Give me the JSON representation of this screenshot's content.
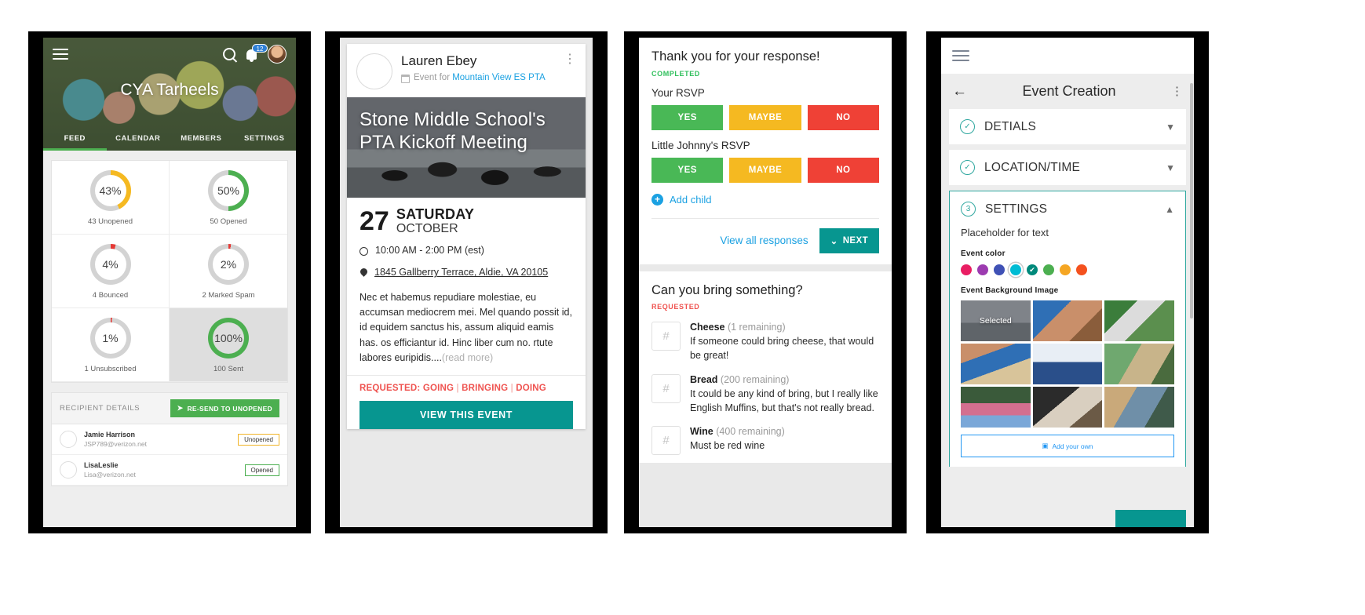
{
  "phone1": {
    "header": {
      "menu_icon": "hamburger-icon",
      "search_icon": "search-icon",
      "bell_icon": "bell-icon",
      "notification_count": "12",
      "avatar": "user-avatar",
      "group_title": "CYA Tarheels"
    },
    "tabs": [
      {
        "label": "FEED",
        "active": true
      },
      {
        "label": "CALENDAR",
        "active": false
      },
      {
        "label": "MEMBERS",
        "active": false
      },
      {
        "label": "SETTINGS",
        "active": false
      }
    ],
    "stats": [
      {
        "percent": "43%",
        "label": "43 Unopened",
        "color": "#f5b921",
        "pct": 43,
        "shaded": false
      },
      {
        "percent": "50%",
        "label": "50 Opened",
        "color": "#4caf50",
        "pct": 50,
        "shaded": false
      },
      {
        "percent": "4%",
        "label": "4 Bounced",
        "color": "#e53935",
        "pct": 4,
        "shaded": false
      },
      {
        "percent": "2%",
        "label": "2 Marked Spam",
        "color": "#e53935",
        "pct": 2,
        "shaded": false
      },
      {
        "percent": "1%",
        "label": "1 Unsubscribed",
        "color": "#e53935",
        "pct": 1,
        "shaded": false
      },
      {
        "percent": "100%",
        "label": "100 Sent",
        "color": "#4caf50",
        "pct": 100,
        "shaded": true
      }
    ],
    "recipients": {
      "section_title": "RECIPIENT DETAILS",
      "resend_label": "RE-SEND TO UNOPENED",
      "send_icon": "send-icon",
      "rows": [
        {
          "name": "Jamie Harrison",
          "email": "JSP789@verizon.net",
          "status": "Unopened",
          "status_color": "#f0b429"
        },
        {
          "name": "LisaLeslie",
          "email": "Lisa@verizon.net",
          "status": "Opened",
          "status_color": "#4caf50"
        }
      ]
    }
  },
  "phone2": {
    "author": "Lauren Ebey",
    "calendar_icon": "calendar-icon",
    "subtitle_prefix": "Event for ",
    "subtitle_link": "Mountain View ES PTA",
    "kebab_icon": "more-vertical-icon",
    "banner_title": "Stone Middle School's PTA Kickoff Meeting",
    "date_number": "27",
    "date_dow": "SATURDAY",
    "date_month": "OCTOBER",
    "clock_icon": "clock-icon",
    "time": "10:00 AM - 2:00 PM (est)",
    "pin_icon": "location-pin-icon",
    "address": "1845 Gallberry Terrace, Aldie, VA 20105",
    "description": "Nec et habemus repudiare molestiae, eu accumsan mediocrem mei. Mel quando possit id, id equidem sanctus his, assum aliquid eamis has. os efficiantur id. Hinc liber cum no. rtute labores euripidis....",
    "read_more": "(read more)",
    "requested_label": "REQUESTED:",
    "requested_items": [
      "GOING",
      "BRINGING",
      "DOING"
    ],
    "cta_label": "VIEW THIS EVENT"
  },
  "phone3": {
    "thanks_title": "Thank you for your response!",
    "status_completed": "COMPLETED",
    "your_rsvp_label": "Your RSVP",
    "child_rsvp_label": "Little Johnny's RSVP",
    "rsvp_buttons": [
      "YES",
      "MAYBE",
      "NO"
    ],
    "add_child_label": "Add child",
    "add_child_icon": "plus-circle-icon",
    "view_all_label": "View all responses",
    "next_label": "NEXT",
    "next_icon": "chevron-down-icon",
    "bring_title": "Can you bring something?",
    "status_requested": "REQUESTED",
    "bring_items": [
      {
        "icon": "hash-icon",
        "name": "Cheese",
        "remaining": "(1 remaining)",
        "desc": "If someone could bring cheese, that would be great!"
      },
      {
        "icon": "hash-icon",
        "name": "Bread",
        "remaining": "(200 remaining)",
        "desc": "It could be any kind of bring, but I really like English Muffins, but that's not really bread."
      },
      {
        "icon": "hash-icon",
        "name": "Wine",
        "remaining": "(400 remaining)",
        "desc": "Must be red wine"
      }
    ]
  },
  "phone4": {
    "menu_icon": "hamburger-icon",
    "back_icon": "arrow-left-icon",
    "title": "Event Creation",
    "kebab_icon": "more-vertical-icon",
    "sections": [
      {
        "label": "DETIALS",
        "marker": "check",
        "marker_text": "✓",
        "open": false,
        "chevron": "⌄"
      },
      {
        "label": "LOCATION/TIME",
        "marker": "check",
        "marker_text": "✓",
        "open": false,
        "chevron": "⌄"
      },
      {
        "label": "SETTINGS",
        "marker": "number",
        "marker_text": "3",
        "open": true,
        "chevron": "⌃"
      }
    ],
    "settings": {
      "placeholder_text": "Placeholder for text",
      "event_color_label": "Event color",
      "colors": [
        {
          "hex": "#e91e63",
          "state": "none"
        },
        {
          "hex": "#9c3bb0",
          "state": "none"
        },
        {
          "hex": "#3f51b5",
          "state": "none"
        },
        {
          "hex": "#00bcd4",
          "state": "ring"
        },
        {
          "hex": "#00897b",
          "state": "check"
        },
        {
          "hex": "#4caf50",
          "state": "none"
        },
        {
          "hex": "#f5a623",
          "state": "none"
        },
        {
          "hex": "#f4511e",
          "state": "none"
        }
      ],
      "bg_image_label": "Event Background Image",
      "images": [
        {
          "selected_label": "Selected",
          "selected": true
        },
        {
          "selected_label": "",
          "selected": false
        },
        {
          "selected_label": "",
          "selected": false
        },
        {
          "selected_label": "",
          "selected": false
        },
        {
          "selected_label": "",
          "selected": false
        },
        {
          "selected_label": "",
          "selected": false
        },
        {
          "selected_label": "",
          "selected": false
        },
        {
          "selected_label": "",
          "selected": false
        },
        {
          "selected_label": "",
          "selected": false
        }
      ],
      "add_own_label": "Add your own",
      "add_own_icon": "image-icon"
    }
  }
}
